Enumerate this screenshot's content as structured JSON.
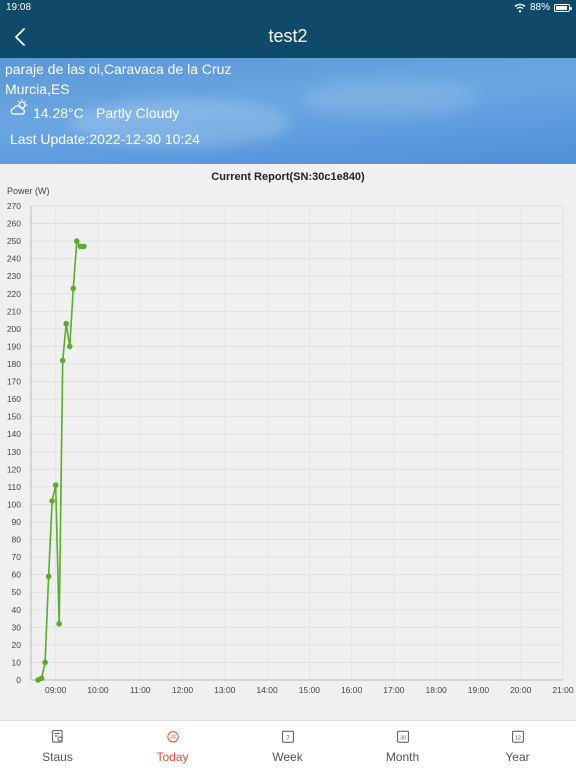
{
  "status_bar": {
    "time": "19:08",
    "battery": "88%",
    "battery_level": 0.88
  },
  "nav": {
    "title": "test2"
  },
  "weather": {
    "address_line1": "paraje de las oi,Caravaca de la Cruz",
    "address_line2": "Murcia,ES",
    "temperature": "14.28°C",
    "condition": "Partly Cloudy",
    "last_update": "Last Update:2022-12-30 10:24",
    "icon": "partly-cloudy-icon"
  },
  "chart_data": {
    "type": "line",
    "title": "Current Report(SN:30c1e840)",
    "ylabel": "Power (W)",
    "xlabel": "",
    "ylim": [
      0,
      270
    ],
    "y_ticks": [
      0,
      10,
      20,
      30,
      40,
      50,
      60,
      70,
      80,
      90,
      100,
      110,
      120,
      130,
      140,
      150,
      160,
      170,
      180,
      190,
      200,
      210,
      220,
      230,
      240,
      250,
      260,
      270
    ],
    "x_ticks": [
      "09:00",
      "10:00",
      "11:00",
      "12:00",
      "13:00",
      "14:00",
      "15:00",
      "16:00",
      "17:00",
      "18:00",
      "19:00",
      "20:00",
      "21:00"
    ],
    "grid": true,
    "line_color": "#5aab2e",
    "series": [
      {
        "x": [
          "08:35",
          "08:40",
          "08:45",
          "08:50",
          "08:55",
          "09:00",
          "09:05",
          "09:10",
          "09:15",
          "09:20",
          "09:25",
          "09:30",
          "09:35",
          "09:40"
        ],
        "values": [
          0,
          1,
          10,
          59,
          102,
          111,
          32,
          182,
          203,
          190,
          223,
          250,
          247,
          247
        ]
      }
    ]
  },
  "tabs": [
    {
      "label": "Staus",
      "icon": "status-report-icon",
      "active": false
    },
    {
      "label": "Today",
      "icon": "today-24h-icon",
      "active": true
    },
    {
      "label": "Week",
      "icon": "calendar-7-icon",
      "active": false
    },
    {
      "label": "Month",
      "icon": "calendar-30-icon",
      "active": false
    },
    {
      "label": "Year",
      "icon": "calendar-12-icon",
      "active": false
    }
  ],
  "colors": {
    "header": "#0f4a6a",
    "active_tab": "#e74c3c",
    "line": "#5aab2e"
  }
}
